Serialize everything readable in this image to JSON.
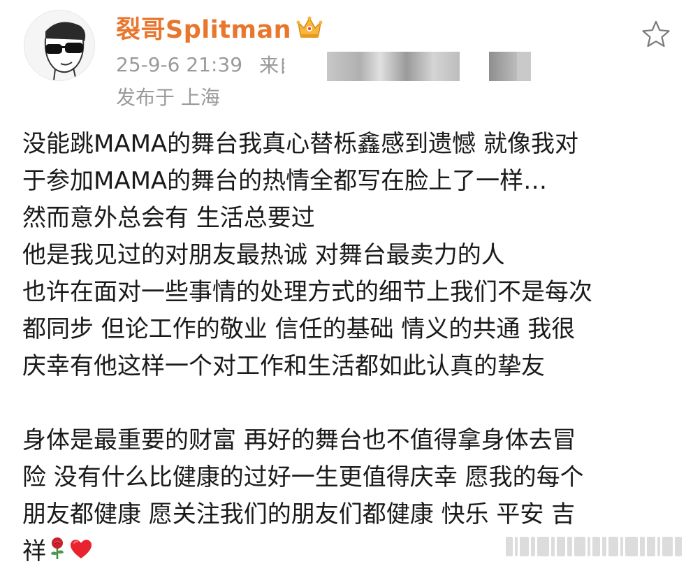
{
  "post": {
    "author": {
      "name": "裂哥Splitman",
      "badge_icon": "crown-icon",
      "name_color": "#e8762c"
    },
    "timestamp": "25-9-6 21:39",
    "source_label": "来自",
    "location": "发布于 上海",
    "favorite_icon": "star-outline-icon",
    "content_lines": [
      "没能跳MAMA的舞台我真心替栎鑫感到遗憾 就像我对",
      "于参加MAMA的舞台的热情全都写在脸上了一样…",
      "然而意外总会有 生活总要过",
      "他是我见过的对朋友最热诚 对舞台最卖力的人",
      "也许在面对一些事情的处理方式的细节上我们不是每次",
      "都同步 但论工作的敬业 信任的基础 情义的共通 我很",
      "庆幸有他这样一个对工作和生活都如此认真的挚友"
    ],
    "content_lines_2": [
      "身体是最重要的财富 再好的舞台也不值得拿身体去冒",
      "险 没有什么比健康的过好一生更值得庆幸 愿我的每个",
      "朋友都健康 愿关注我们的朋友们都健康 快乐 平安 吉"
    ],
    "last_line_text": "祥",
    "last_line_emojis": [
      "rose-icon",
      "heart-icon"
    ]
  }
}
